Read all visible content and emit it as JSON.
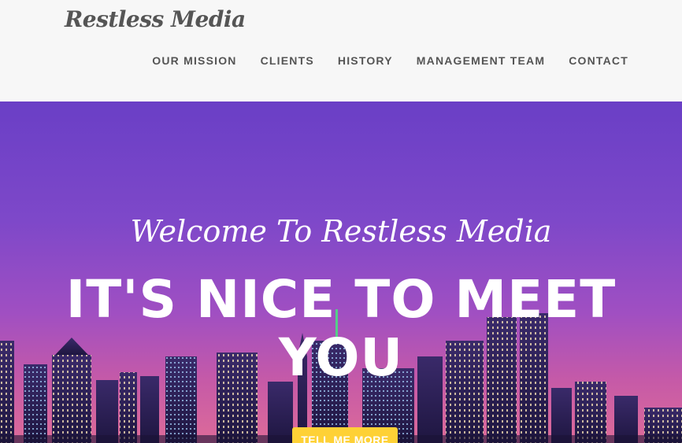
{
  "brand": {
    "name": "Restless Media"
  },
  "nav": {
    "items": [
      {
        "label": "OUR MISSION"
      },
      {
        "label": "CLIENTS"
      },
      {
        "label": "HISTORY"
      },
      {
        "label": "MANAGEMENT TEAM"
      },
      {
        "label": "CONTACT"
      }
    ]
  },
  "hero": {
    "lead": "Welcome To Restless Media",
    "heading": "IT'S NICE TO MEET YOU",
    "cta_label": "TELL ME MORE"
  },
  "colors": {
    "navbar_bg": "#f7f7f7",
    "nav_text": "#555555",
    "hero_top": "#6a3fc6",
    "hero_bottom": "#dd6b99",
    "cta_bg": "#fed136",
    "hero_text": "#ffffff"
  }
}
